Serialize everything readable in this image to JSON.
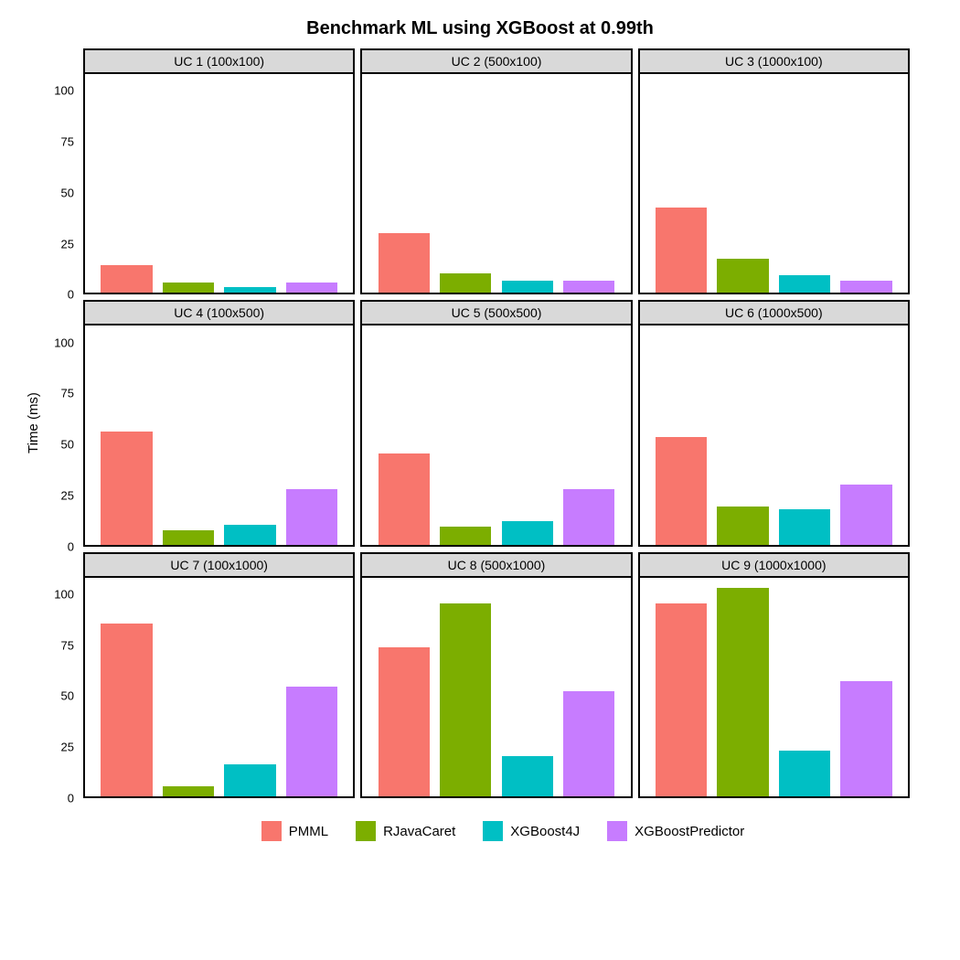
{
  "chart_data": {
    "type": "bar",
    "title": "Benchmark ML using XGBoost at 0.99th",
    "ylabel": "Time (ms)",
    "ylim": [
      0,
      110
    ],
    "y_ticks": [
      0,
      25,
      50,
      75,
      100
    ],
    "series_names": [
      "PMML",
      "RJavaCaret",
      "XGBoost4J",
      "XGBoostPredictor"
    ],
    "series_colors": [
      "#F8766D",
      "#7CAE00",
      "#00BFC4",
      "#C77CFF"
    ],
    "facets": [
      {
        "label": "UC 1 (100x100)",
        "values": [
          14,
          5,
          3,
          5
        ]
      },
      {
        "label": "UC 2 (500x100)",
        "values": [
          30,
          10,
          6,
          6
        ]
      },
      {
        "label": "UC 3 (1000x100)",
        "values": [
          43,
          17,
          9,
          6
        ]
      },
      {
        "label": "UC 4 (100x500)",
        "values": [
          57,
          7,
          10,
          28
        ]
      },
      {
        "label": "UC 5 (500x500)",
        "values": [
          46,
          9,
          12,
          28
        ]
      },
      {
        "label": "UC 6 (1000x500)",
        "values": [
          54,
          19,
          18,
          30
        ]
      },
      {
        "label": "UC 7 (100x1000)",
        "values": [
          87,
          5,
          16,
          55
        ]
      },
      {
        "label": "UC 8 (500x1000)",
        "values": [
          75,
          97,
          20,
          53
        ]
      },
      {
        "label": "UC 9 (1000x1000)",
        "values": [
          97,
          105,
          23,
          58
        ]
      }
    ]
  }
}
